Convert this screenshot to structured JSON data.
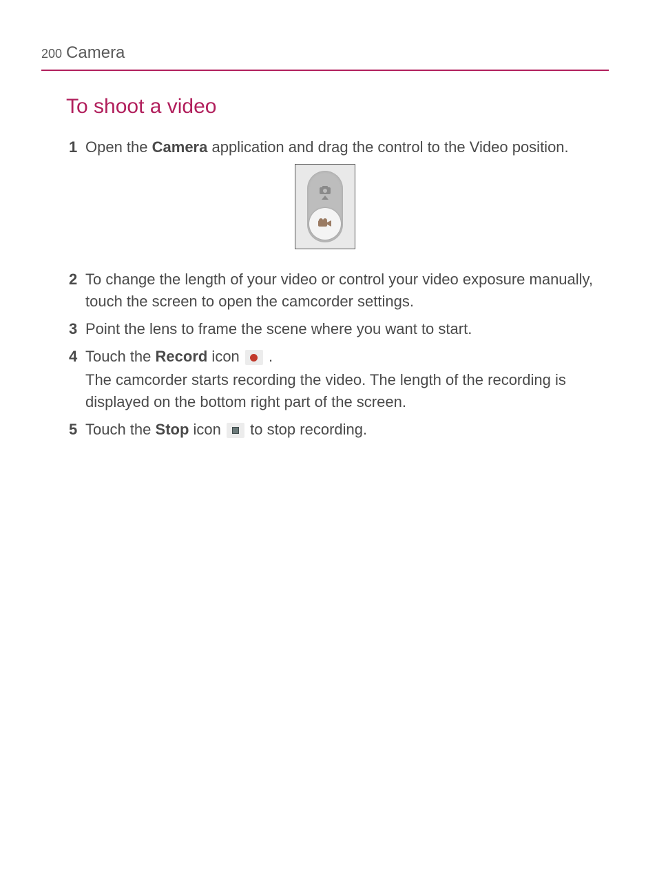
{
  "header": {
    "page_number": "200",
    "title": "Camera"
  },
  "section": {
    "title": "To shoot a video"
  },
  "steps": {
    "s1": {
      "num": "1",
      "pre": " Open the ",
      "bold": "Camera",
      "post": " application and drag the control to the Video position."
    },
    "s2": {
      "num": "2",
      "text": " To change the length of your video or control your video exposure manually, touch the screen to open the camcorder settings."
    },
    "s3": {
      "num": "3",
      "text": " Point the lens to frame the scene where you want to start."
    },
    "s4": {
      "num": "4",
      "pre": " Touch the ",
      "bold": "Record",
      "mid": " icon ",
      "post": " .",
      "continuation": "The camcorder starts recording the video. The length of the recording is displayed on the bottom right part of the screen."
    },
    "s5": {
      "num": "5",
      "pre": " Touch the ",
      "bold": "Stop",
      "mid": " icon ",
      "post": " to stop recording."
    }
  },
  "icons": {
    "camera": "camera-icon",
    "arrow": "arrow-up-icon",
    "camcorder": "camcorder-icon",
    "record": "record-icon",
    "stop": "stop-icon"
  }
}
